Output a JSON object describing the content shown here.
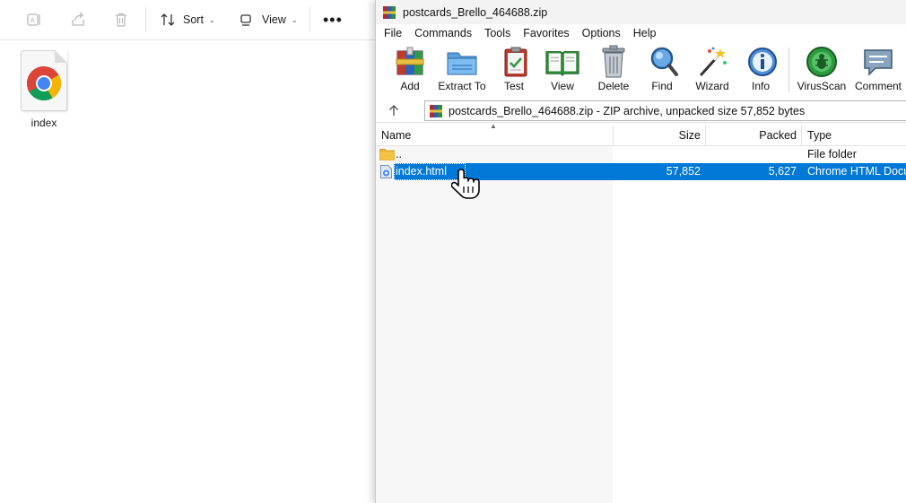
{
  "explorer": {
    "toolbar": {
      "sort_label": "Sort",
      "view_label": "View"
    },
    "desktop_file": {
      "label": "index",
      "icon": "chrome-html-file-icon"
    }
  },
  "winrar": {
    "title": "postcards_Brello_464688.zip",
    "menu": [
      "File",
      "Commands",
      "Tools",
      "Favorites",
      "Options",
      "Help"
    ],
    "toolbar": [
      {
        "label": "Add",
        "icon": "add-archive-icon"
      },
      {
        "label": "Extract To",
        "icon": "extract-folder-icon"
      },
      {
        "label": "Test",
        "icon": "test-clipboard-icon"
      },
      {
        "label": "View",
        "icon": "view-book-icon"
      },
      {
        "label": "Delete",
        "icon": "trash-can-icon"
      },
      {
        "label": "Find",
        "icon": "magnifier-icon"
      },
      {
        "label": "Wizard",
        "icon": "magic-wand-icon"
      },
      {
        "label": "Info",
        "icon": "info-icon"
      },
      {
        "label": "VirusScan",
        "icon": "virus-scan-icon"
      },
      {
        "label": "Comment",
        "icon": "comment-icon"
      }
    ],
    "address": "postcards_Brello_464688.zip - ZIP archive, unpacked size 57,852 bytes",
    "columns": {
      "name": "Name",
      "size": "Size",
      "packed": "Packed",
      "type": "Type"
    },
    "rows": [
      {
        "name": "..",
        "size": "",
        "packed": "",
        "type": "File folder",
        "selected": false
      },
      {
        "name": "index.html",
        "size": "57,852",
        "packed": "5,627",
        "type": "Chrome HTML Docu",
        "selected": true
      }
    ]
  },
  "colors": {
    "selection": "#0078d7",
    "folder": "#f5c342"
  }
}
